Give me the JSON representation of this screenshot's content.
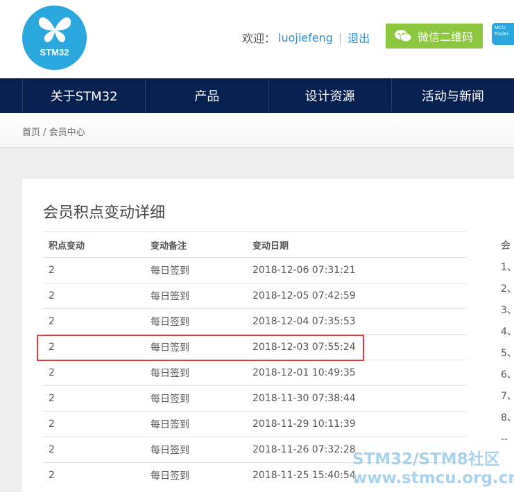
{
  "header": {
    "logo_text": "STM32",
    "welcome_label": "欢迎：",
    "username": "luojiefeng",
    "separator": "|",
    "logout_label": "退出",
    "wechat_button": "微信二维码",
    "mcu_finder_line1": "MCU",
    "mcu_finder_line2": "Finder"
  },
  "nav": {
    "items": [
      "关于STM32",
      "产品",
      "设计资源",
      "活动与新闻"
    ]
  },
  "breadcrumb": "首页 / 会员中心",
  "main": {
    "title": "会员积点变动详细",
    "columns": [
      "积点变动",
      "变动备注",
      "变动日期"
    ],
    "rows": [
      [
        "2",
        "每日签到",
        "2018-12-06 07:31:21"
      ],
      [
        "2",
        "每日签到",
        "2018-12-05 07:42:59"
      ],
      [
        "2",
        "每日签到",
        "2018-12-04 07:35:53"
      ],
      [
        "2",
        "每日签到",
        "2018-12-03 07:55:24"
      ],
      [
        "2",
        "每日签到",
        "2018-12-01 10:49:35"
      ],
      [
        "2",
        "每日签到",
        "2018-11-30 07:38:44"
      ],
      [
        "2",
        "每日签到",
        "2018-11-29 10:11:39"
      ],
      [
        "2",
        "每日签到",
        "2018-11-26 07:32:28"
      ],
      [
        "2",
        "每日签到",
        "2018-11-25 15:40:54"
      ]
    ]
  },
  "side": {
    "heading": "会",
    "items": [
      "1、",
      "2、",
      "3、",
      "4、",
      "5、",
      "6、",
      "7、",
      "8、",
      "--"
    ]
  },
  "watermark": {
    "line1": "STM32/STM8社区",
    "line2": "www.stmcu.org.cn"
  },
  "colors": {
    "nav_bg": "#062050",
    "brand_blue": "#2aa7dd",
    "wechat_green": "#8dc63f",
    "highlight_red": "#e03a3a",
    "link": "#2a8ed8"
  }
}
